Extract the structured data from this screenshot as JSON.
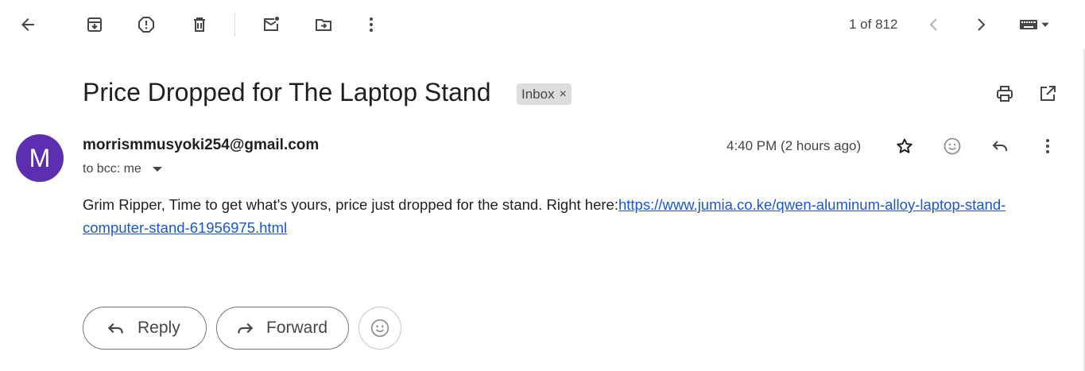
{
  "toolbar": {
    "back_icon": "arrow-left-icon",
    "archive_icon": "archive-icon",
    "spam_icon": "report-spam-icon",
    "delete_icon": "trash-icon",
    "mark_unread_icon": "mark-unread-icon",
    "move_icon": "move-to-icon",
    "more_icon": "more-vertical-icon",
    "pager_text": "1 of 812",
    "input_tools_icon": "keyboard-icon"
  },
  "email": {
    "subject": "Price Dropped for The Laptop Stand",
    "label": "Inbox",
    "label_close": "×",
    "sender_initial": "M",
    "avatar_color": "#5b2fb0",
    "sender": "morrismmusyoki254@gmail.com",
    "to_line": "to bcc: me",
    "time": "4:40 PM (2 hours ago)",
    "body_text": "Grim Ripper, Time to get what's yours, price just dropped for the stand. Right here:",
    "body_link": "https://www.jumia.co.ke/qwen-aluminum-alloy-laptop-stand-computer-stand-61956975.html",
    "link_color": "#1a57d0"
  },
  "actions": {
    "reply_label": "Reply",
    "forward_label": "Forward"
  }
}
